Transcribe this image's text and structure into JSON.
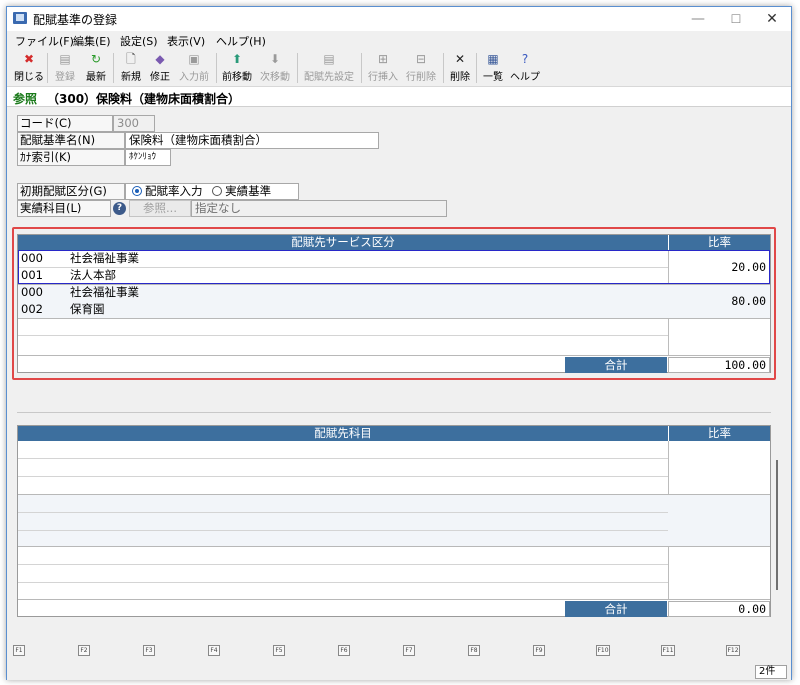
{
  "window": {
    "title": "配賦基準の登録",
    "minimize": "—",
    "maximize": "☐",
    "close": "✕"
  },
  "menu": [
    "ファイル(F)",
    "編集(E)",
    "設定(S)",
    "表示(V)",
    "ヘルプ(H)"
  ],
  "toolbar": [
    {
      "label": "閉じる",
      "icon": "close-icon",
      "glyph": "✖",
      "color": "#d42c2c",
      "enabled": true
    },
    {
      "label": "登録",
      "icon": "save-icon",
      "glyph": "▤",
      "color": "#9a9a9a",
      "enabled": false
    },
    {
      "label": "最新",
      "icon": "refresh-icon",
      "glyph": "↻",
      "color": "#2a9a2a",
      "enabled": true
    },
    {
      "label": "新規",
      "icon": "new-doc-icon",
      "glyph": "🗋",
      "color": "#555555",
      "enabled": true
    },
    {
      "label": "修正",
      "icon": "edit-icon",
      "glyph": "◆",
      "color": "#7a5ab0",
      "enabled": true
    },
    {
      "label": "入力前",
      "icon": "undo-icon",
      "glyph": "▣",
      "color": "#9a9a9a",
      "enabled": false
    },
    {
      "label": "前移動",
      "icon": "up-arrow-icon",
      "glyph": "⬆",
      "color": "#2a9a7a",
      "enabled": true
    },
    {
      "label": "次移動",
      "icon": "down-arrow-icon",
      "glyph": "⬇",
      "color": "#9a9a9a",
      "enabled": false
    },
    {
      "label": "配賦先設定",
      "icon": "settings-doc-icon",
      "glyph": "▤",
      "color": "#9a9a9a",
      "enabled": false
    },
    {
      "label": "行挿入",
      "icon": "insert-row-icon",
      "glyph": "⊞",
      "color": "#9a9a9a",
      "enabled": false
    },
    {
      "label": "行削除",
      "icon": "delete-row-icon",
      "glyph": "⊟",
      "color": "#9a9a9a",
      "enabled": false
    },
    {
      "label": "削除",
      "icon": "delete-icon",
      "glyph": "✕",
      "color": "#222222",
      "enabled": true
    },
    {
      "label": "一覧",
      "icon": "list-icon",
      "glyph": "▦",
      "color": "#3a5a9a",
      "enabled": true
    },
    {
      "label": "ヘルプ",
      "icon": "help-icon",
      "glyph": "?",
      "color": "#3a5ac0",
      "enabled": true
    }
  ],
  "breadcrumb": {
    "mode": "参照",
    "title": "（300）保険料（建物床面積割合）"
  },
  "form": {
    "code_label": "コード(C)",
    "code_value": "300",
    "name_label": "配賦基準名(N)",
    "name_value": "保険料（建物床面積割合）",
    "kana_label": "ｶﾅ索引(K)",
    "kana_value": "ﾎｹﾝﾘｮｳ",
    "initial_label": "初期配賦区分(G)",
    "radio_ratio": "配賦率入力",
    "radio_actual": "実績基準",
    "account_label": "実績科目(L)",
    "browse_button": "参照...",
    "account_value": "指定なし"
  },
  "grid1": {
    "header_service": "配賦先サービス区分",
    "header_ratio": "比率",
    "rows": [
      {
        "code1": "000",
        "name1": "社会福祉事業",
        "code2": "001",
        "name2": "法人本部",
        "ratio": "20.00"
      },
      {
        "code1": "000",
        "name1": "社会福祉事業",
        "code2": "002",
        "name2": "保育園",
        "ratio": "80.00"
      }
    ],
    "total_label": "合計",
    "total_value": "100.00"
  },
  "grid2": {
    "header_account": "配賦先科目",
    "header_ratio": "比率",
    "total_label": "合計",
    "total_value": "0.00"
  },
  "fkeys": [
    "F1",
    "F2",
    "F3",
    "F4",
    "F5",
    "F6",
    "F7",
    "F8",
    "F9",
    "F10",
    "F11",
    "F12"
  ],
  "status": {
    "count": "2件"
  },
  "colors": {
    "header": "#3d6f9e",
    "highlight": "#e04848",
    "selection": "#2828c8",
    "mode_text": "#1a7a1a"
  }
}
